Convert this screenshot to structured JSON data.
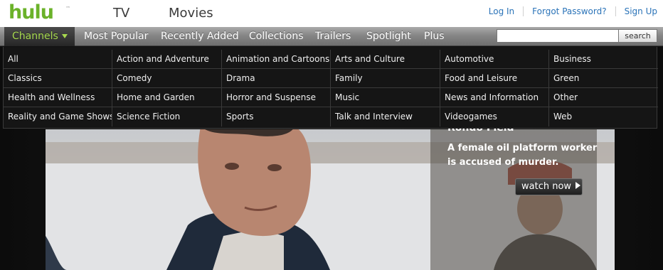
{
  "logo": {
    "text": "hulu",
    "tm": "™"
  },
  "top_tabs": [
    "TV",
    "Movies"
  ],
  "auth_links": [
    "Log In",
    "Forgot Password?",
    "Sign Up"
  ],
  "nav": {
    "channels_label": "Channels",
    "items": [
      "Most Popular",
      "Recently Added",
      "Collections",
      "Trailers",
      "Spotlight",
      "Plus"
    ]
  },
  "search": {
    "button_label": "search",
    "value": "",
    "placeholder": ""
  },
  "channels": [
    [
      "All",
      "Action and Adventure",
      "Animation and Cartoons",
      "Arts and Culture",
      "Automotive",
      "Business"
    ],
    [
      "Classics",
      "Comedy",
      "Drama",
      "Family",
      "Food and Leisure",
      "Green"
    ],
    [
      "Health and Wellness",
      "Home and Garden",
      "Horror and Suspense",
      "Music",
      "News and Information",
      "Other"
    ],
    [
      "Reality and Game Shows",
      "Science Fiction",
      "Sports",
      "Talk and Interview",
      "Videogames",
      "Web"
    ]
  ],
  "hero": {
    "title": "Rondo Field",
    "description": "A female oil platform worker is accused of murder.",
    "watch_label": "watch now"
  },
  "colors": {
    "brand_green": "#6bb22a",
    "link_blue": "#2a73b8",
    "channels_text": "#a7d94f"
  }
}
